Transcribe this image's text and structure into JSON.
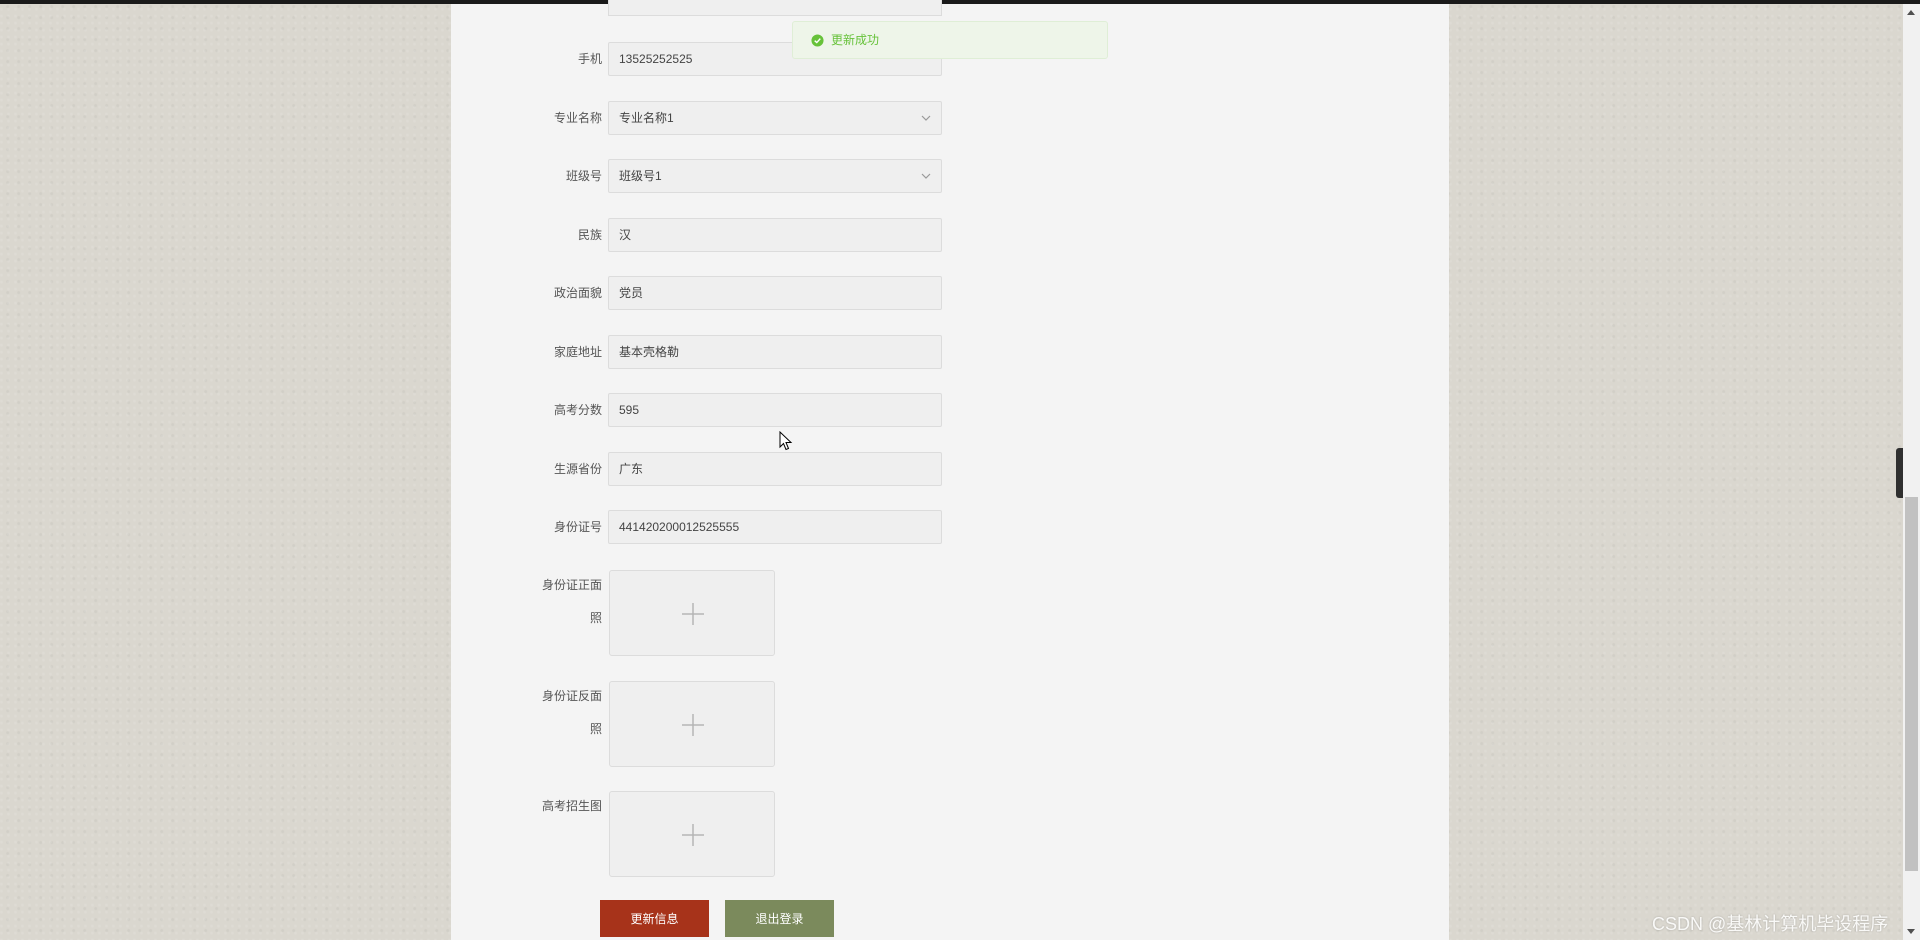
{
  "form": {
    "fields": [
      {
        "label": "手机",
        "value": "13525252525",
        "type": "input"
      },
      {
        "label": "专业名称",
        "value": "专业名称1",
        "type": "select"
      },
      {
        "label": "班级号",
        "value": "班级号1",
        "type": "select"
      },
      {
        "label": "民族",
        "value": "汉",
        "type": "input"
      },
      {
        "label": "政治面貌",
        "value": "党员",
        "type": "input"
      },
      {
        "label": "家庭地址",
        "value": "基本壳格勒",
        "type": "input"
      },
      {
        "label": "高考分数",
        "value": "595",
        "type": "input"
      },
      {
        "label": "生源省份",
        "value": "广东",
        "type": "input"
      },
      {
        "label": "身份证号",
        "value": "441420200012525555",
        "type": "input"
      }
    ],
    "uploads": [
      {
        "label_line1": "身份证正面",
        "label_line2": "照"
      },
      {
        "label_line1": "身份证反面",
        "label_line2": "照"
      },
      {
        "label_line1": "高考招生图",
        "label_line2": ""
      }
    ],
    "buttons": {
      "update": "更新信息",
      "logout": "退出登录"
    }
  },
  "toast": {
    "message": "更新成功",
    "status_color": "#67c23a"
  },
  "watermark": "CSDN @基林计算机毕设程序",
  "colors": {
    "update_button": "#a7331a",
    "logout_button": "#7b8a5c"
  }
}
